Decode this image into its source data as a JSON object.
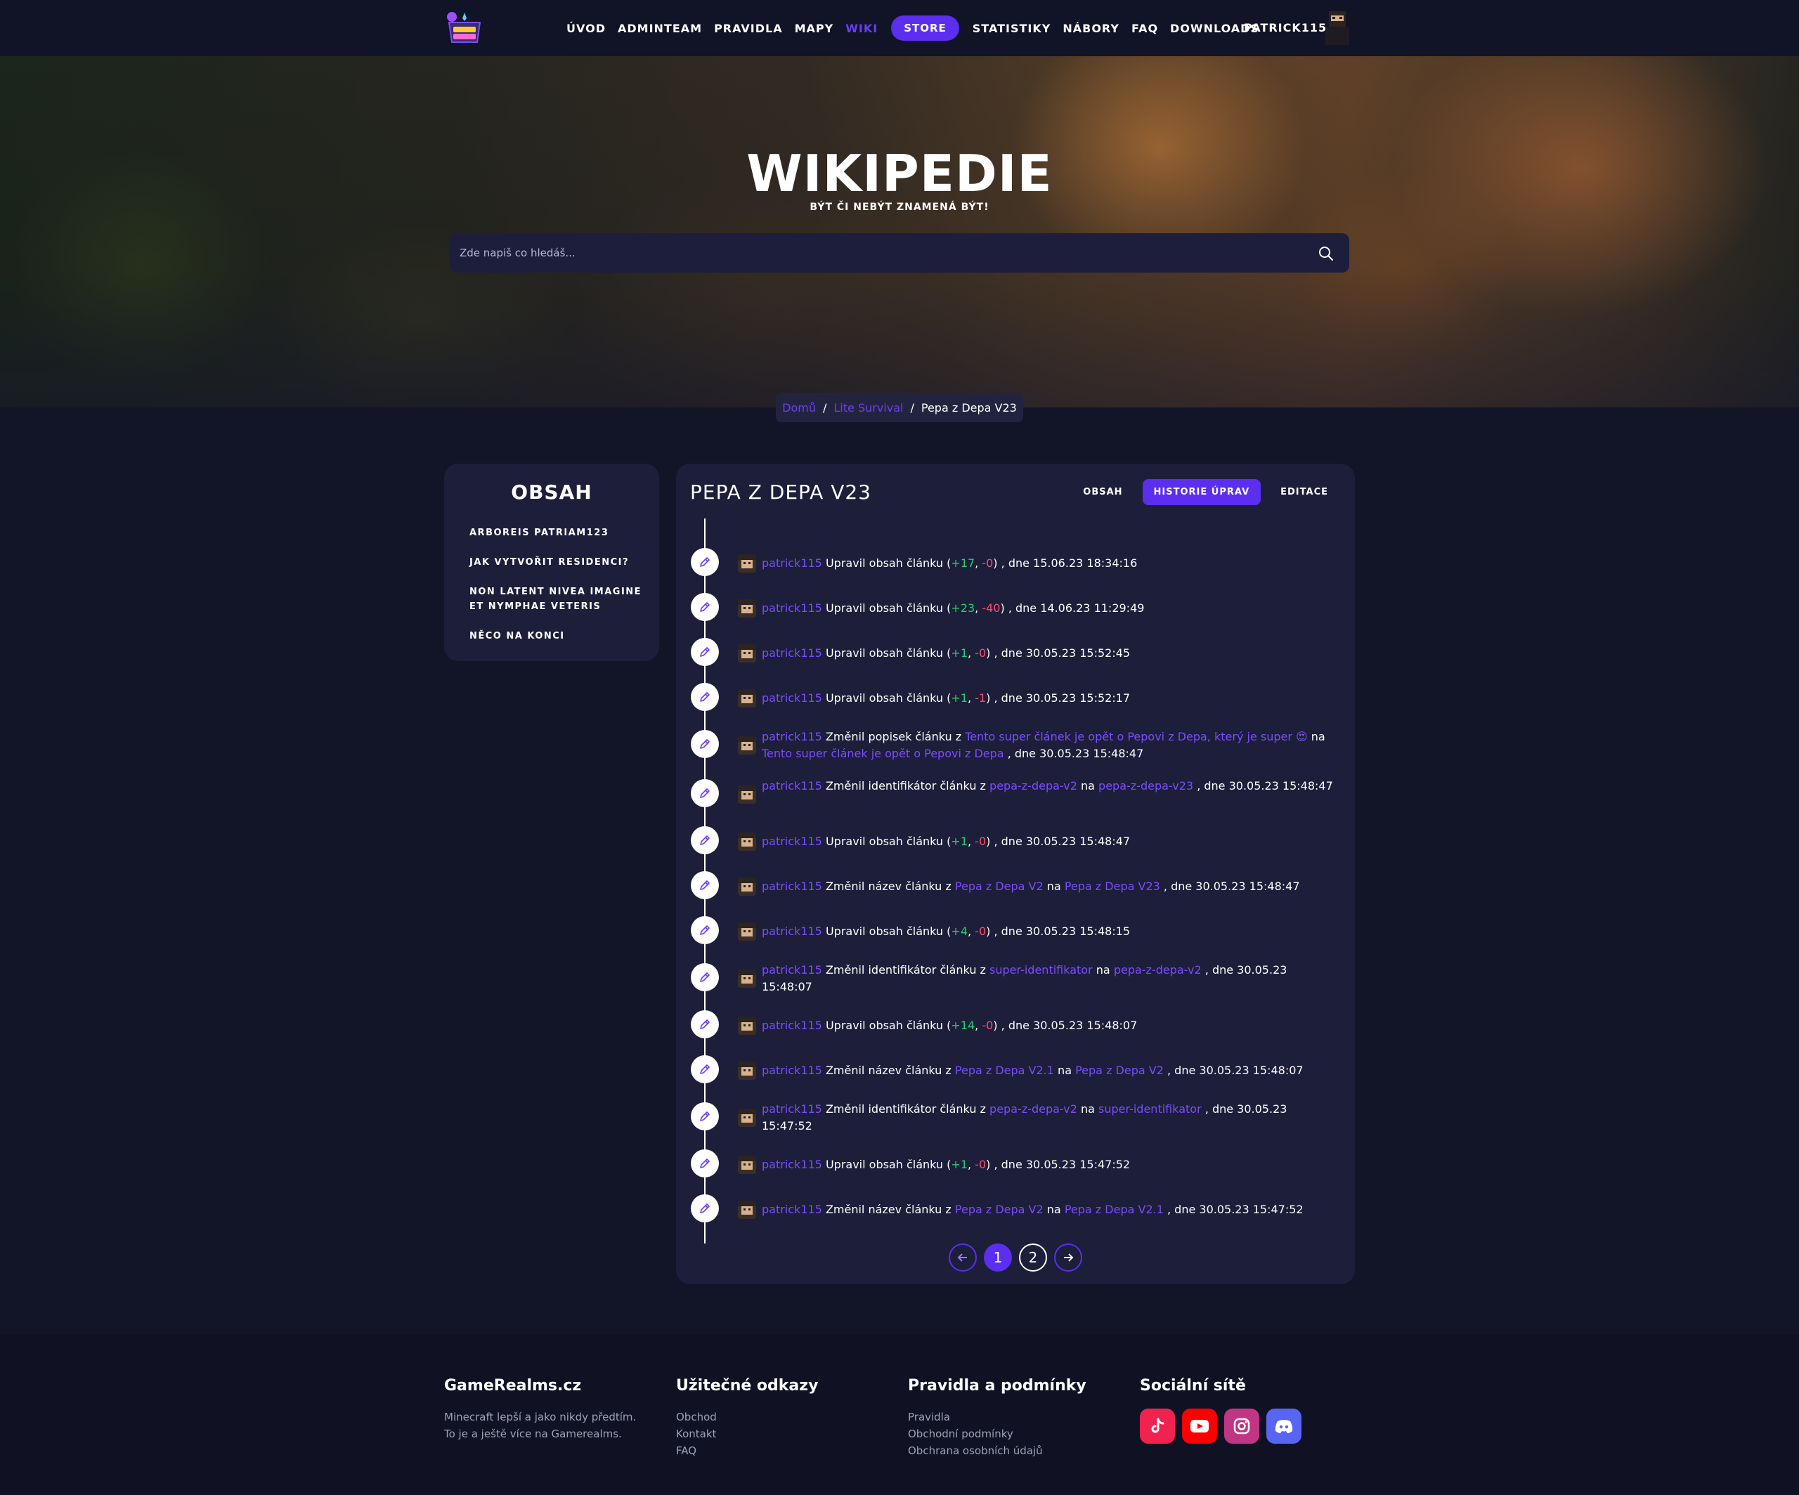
{
  "nav": {
    "items": [
      {
        "label": "ÚVOD",
        "active": false
      },
      {
        "label": "ADMINTEAM",
        "active": false
      },
      {
        "label": "PRAVIDLA",
        "active": false
      },
      {
        "label": "MAPY",
        "active": false
      },
      {
        "label": "WIKI",
        "active": true
      }
    ],
    "store_label": "STORE",
    "items_after": [
      {
        "label": "STATISTIKY"
      },
      {
        "label": "NÁBORY"
      },
      {
        "label": "FAQ"
      },
      {
        "label": "DOWNLOADS"
      }
    ],
    "username": "PATRICK115",
    "logo_icon": "gamerealms-logo",
    "accent": "#5b2ef0"
  },
  "hero": {
    "title": "WIKIPEDIE",
    "subtitle": "BÝT ČI NEBÝT ZNAMENÁ BÝT!",
    "search_placeholder": "Zde napiš co hledáš..."
  },
  "breadcrumb": {
    "items": [
      "Domů",
      "Lite Survival"
    ],
    "current": "Pepa z Depa V23"
  },
  "sidebar": {
    "title": "OBSAH",
    "items": [
      "ARBOREIS PATRIAM123",
      "JAK VYTVOŘIT RESIDENCI?",
      "NON LATENT NIVEA IMAGINE ET NYMPHAE VETERIS",
      "NĚCO NA KONCI"
    ]
  },
  "article": {
    "title": "PEPA Z DEPA V23",
    "tabs": [
      {
        "label": "OBSAH",
        "active": false
      },
      {
        "label": "HISTORIE ÚPRAV",
        "active": true
      },
      {
        "label": "EDITACE",
        "active": false
      }
    ],
    "history": [
      {
        "type": "edit",
        "user": "patrick115",
        "action": "Upravil obsah článku",
        "plus": "+17",
        "minus": "-0",
        "date": "15.06.23 18:34:16"
      },
      {
        "type": "edit",
        "user": "patrick115",
        "action": "Upravil obsah článku",
        "plus": "+23",
        "minus": "-40",
        "date": "14.06.23 11:29:49"
      },
      {
        "type": "edit",
        "user": "patrick115",
        "action": "Upravil obsah článku",
        "plus": "+1",
        "minus": "-0",
        "date": "30.05.23 15:52:45"
      },
      {
        "type": "edit",
        "user": "patrick115",
        "action": "Upravil obsah článku",
        "plus": "+1",
        "minus": "-1",
        "date": "30.05.23 15:52:17"
      },
      {
        "type": "change",
        "user": "patrick115",
        "action": "Změnil popisek článku z",
        "from": "Tento super článek je opět o Pepovi z Depa, který je super 😍",
        "to": "Tento super článek je opět o Pepovi z Depa",
        "date": "30.05.23 15:48:47"
      },
      {
        "type": "change",
        "user": "patrick115",
        "action": "Změnil identifikátor článku z",
        "from": "pepa-z-depa-v2",
        "to": "pepa-z-depa-v23",
        "date": "30.05.23 15:48:47"
      },
      {
        "type": "edit",
        "user": "patrick115",
        "action": "Upravil obsah článku",
        "plus": "+1",
        "minus": "-0",
        "date": "30.05.23 15:48:47"
      },
      {
        "type": "change",
        "user": "patrick115",
        "action": "Změnil název článku z",
        "from": "Pepa z Depa V2",
        "to": "Pepa z Depa V23",
        "date": "30.05.23 15:48:47"
      },
      {
        "type": "edit",
        "user": "patrick115",
        "action": "Upravil obsah článku",
        "plus": "+4",
        "minus": "-0",
        "date": "30.05.23 15:48:15"
      },
      {
        "type": "change",
        "user": "patrick115",
        "action": "Změnil identifikátor článku z",
        "from": "super-identifikator",
        "to": "pepa-z-depa-v2",
        "date": "30.05.23 15:48:07"
      },
      {
        "type": "edit",
        "user": "patrick115",
        "action": "Upravil obsah článku",
        "plus": "+14",
        "minus": "-0",
        "date": "30.05.23 15:48:07"
      },
      {
        "type": "change",
        "user": "patrick115",
        "action": "Změnil název článku z",
        "from": "Pepa z Depa V2.1",
        "to": "Pepa z Depa V2",
        "date": "30.05.23 15:48:07"
      },
      {
        "type": "change",
        "user": "patrick115",
        "action": "Změnil identifikátor článku z",
        "from": "pepa-z-depa-v2",
        "to": "super-identifikator",
        "date": "30.05.23 15:47:52"
      },
      {
        "type": "edit",
        "user": "patrick115",
        "action": "Upravil obsah článku",
        "plus": "+1",
        "minus": "-0",
        "date": "30.05.23 15:47:52"
      },
      {
        "type": "change",
        "user": "patrick115",
        "action": "Změnil název článku z",
        "from": "Pepa z Depa V2",
        "to": "Pepa z Depa V2.1",
        "date": "30.05.23 15:47:52"
      }
    ],
    "joiner_to": "na",
    "joiner_date": ", dne",
    "pagination": {
      "pages": [
        "1",
        "2"
      ],
      "current": "1",
      "prev_icon": "arrow-left-icon",
      "next_icon": "arrow-right-icon"
    }
  },
  "footer": {
    "col1": {
      "title": "GameRealms.cz",
      "lines": [
        "Minecraft lepší a jako nikdy předtím.",
        "To je a ještě více na Gamerealms."
      ]
    },
    "col2": {
      "title": "Užitečné odkazy",
      "links": [
        "Obchod",
        "Kontakt",
        "FAQ"
      ]
    },
    "col3": {
      "title": "Pravidla a podmínky",
      "links": [
        "Pravidla",
        "Obchodní podmínky",
        "Obchrana osobních údajů"
      ]
    },
    "col4": {
      "title": "Sociální sítě",
      "socials": [
        {
          "name": "tiktok-icon",
          "color": "#f0224f"
        },
        {
          "name": "youtube-icon",
          "color": "#ff0000"
        },
        {
          "name": "instagram-icon",
          "color": "#c13584"
        },
        {
          "name": "discord-icon",
          "color": "#5865f2"
        }
      ]
    }
  }
}
